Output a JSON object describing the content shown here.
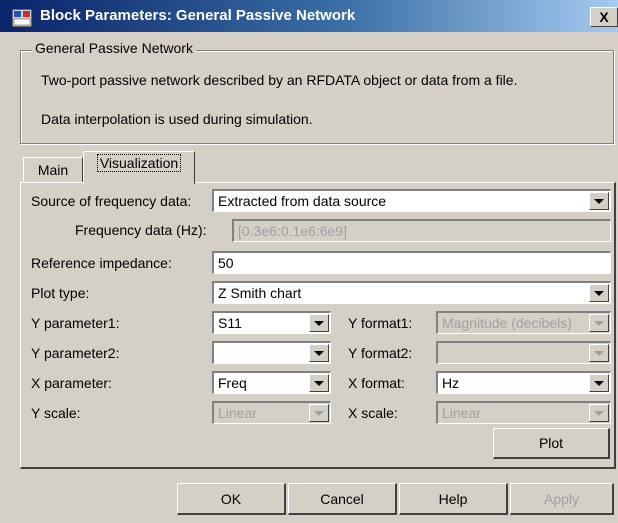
{
  "window": {
    "title": "Block Parameters: General Passive Network",
    "close_label": "X"
  },
  "group": {
    "legend": "General Passive Network",
    "description_line1": "Two-port passive network described by an RFDATA object or data from a file.",
    "description_line2": "Data interpolation is used during simulation."
  },
  "tabs": {
    "main": "Main",
    "visualization": "Visualization"
  },
  "form": {
    "source_freq_label": "Source of frequency data:",
    "source_freq_value": "Extracted from data source",
    "freq_data_label": "Frequency data (Hz):",
    "freq_data_value": "[0.3e6:0.1e6:6e9]",
    "ref_impedance_label": "Reference impedance:",
    "ref_impedance_value": "50",
    "plot_type_label": "Plot type:",
    "plot_type_value": "Z Smith chart",
    "y_param1_label": "Y parameter1:",
    "y_param1_value": "S11",
    "y_format1_label": "Y format1:",
    "y_format1_value": "Magnitude (decibels)",
    "y_param2_label": "Y parameter2:",
    "y_param2_value": "",
    "y_format2_label": "Y format2:",
    "y_format2_value": "",
    "x_param_label": "X parameter:",
    "x_param_value": "Freq",
    "x_format_label": "X format:",
    "x_format_value": "Hz",
    "y_scale_label": "Y scale:",
    "y_scale_value": "Linear",
    "x_scale_label": "X scale:",
    "x_scale_value": "Linear",
    "plot_button": "Plot"
  },
  "buttons": {
    "ok": "OK",
    "cancel": "Cancel",
    "help": "Help",
    "apply": "Apply"
  }
}
